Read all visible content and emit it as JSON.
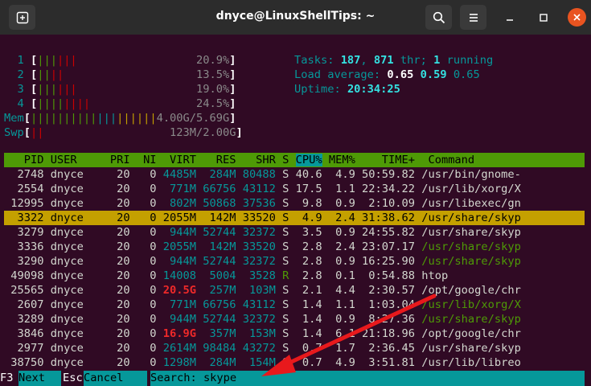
{
  "window": {
    "title": "dnyce@LinuxShellTips: ~"
  },
  "meters": {
    "cpu": [
      {
        "label": "1",
        "bars": "||||||",
        "pct": "20.9%"
      },
      {
        "label": "2",
        "bars": "||||",
        "pct": "13.5%"
      },
      {
        "label": "3",
        "bars": "||||||",
        "pct": "19.0%"
      },
      {
        "label": "4",
        "bars": "||||||||",
        "pct": "24.5%"
      }
    ],
    "mem": {
      "label": "Mem",
      "bars": "|||||||||||||||||||",
      "used": "4.00G",
      "total": "5.69G"
    },
    "swp": {
      "label": "Swp",
      "bars": "||",
      "used": "123M",
      "total": "2.00G"
    }
  },
  "summary": {
    "tasks_label": "Tasks: ",
    "tasks": "187",
    "sep1": ", ",
    "thr": "871",
    "thr_label": " thr; ",
    "running": "1",
    "running_label": " running",
    "load_label": "Load average: ",
    "load1": "0.65",
    "load5": "0.59",
    "load15": "0.65",
    "uptime_label": "Uptime: ",
    "uptime": "20:34:25"
  },
  "table": {
    "headers": {
      "pid": "PID",
      "user": "USER",
      "pri": "PRI",
      "ni": "NI",
      "virt": "VIRT",
      "res": "RES",
      "shr": "SHR",
      "s": "S",
      "cpu": "CPU%",
      "mem": "MEM%",
      "time": "TIME+",
      "cmd": "Command"
    },
    "rows": [
      {
        "pid": "2748",
        "user": "dnyce",
        "pri": "20",
        "ni": "0",
        "virt": "4485M",
        "res": "284M",
        "shr": "80488",
        "s": "S",
        "cpu": "40.6",
        "mem": "4.9",
        "time": "50:59.82",
        "cmd": "/usr/bin/gnome-"
      },
      {
        "pid": "2554",
        "user": "dnyce",
        "pri": "20",
        "ni": "0",
        "virt": "771M",
        "res": "66756",
        "shr": "43112",
        "s": "S",
        "cpu": "17.5",
        "mem": "1.1",
        "time": "22:34.22",
        "cmd": "/usr/lib/xorg/X"
      },
      {
        "pid": "12995",
        "user": "dnyce",
        "pri": "20",
        "ni": "0",
        "virt": "802M",
        "res": "50868",
        "shr": "37536",
        "s": "S",
        "cpu": "9.8",
        "mem": "0.9",
        "time": "2:10.09",
        "cmd": "/usr/libexec/gn"
      },
      {
        "pid": "3322",
        "user": "dnyce",
        "pri": "20",
        "ni": "0",
        "virt": "2055M",
        "res": "142M",
        "shr": "33520",
        "s": "S",
        "cpu": "4.9",
        "mem": "2.4",
        "time": "31:38.62",
        "cmd": "/usr/share/skyp"
      },
      {
        "pid": "3279",
        "user": "dnyce",
        "pri": "20",
        "ni": "0",
        "virt": "944M",
        "res": "52744",
        "shr": "32372",
        "s": "S",
        "cpu": "3.5",
        "mem": "0.9",
        "time": "24:55.82",
        "cmd": "/usr/share/skyp"
      },
      {
        "pid": "3336",
        "user": "dnyce",
        "pri": "20",
        "ni": "0",
        "virt": "2055M",
        "res": "142M",
        "shr": "33520",
        "s": "S",
        "cpu": "2.8",
        "mem": "2.4",
        "time": "23:07.17",
        "cmd": "/usr/share/skyp"
      },
      {
        "pid": "3290",
        "user": "dnyce",
        "pri": "20",
        "ni": "0",
        "virt": "944M",
        "res": "52744",
        "shr": "32372",
        "s": "S",
        "cpu": "2.8",
        "mem": "0.9",
        "time": "16:25.90",
        "cmd": "/usr/share/skyp"
      },
      {
        "pid": "49098",
        "user": "dnyce",
        "pri": "20",
        "ni": "0",
        "virt": "14008",
        "res": "5004",
        "shr": "3528",
        "s": "R",
        "cpu": "2.8",
        "mem": "0.1",
        "time": "0:54.88",
        "cmd": "htop"
      },
      {
        "pid": "25565",
        "user": "dnyce",
        "pri": "20",
        "ni": "0",
        "virt": "20.5G",
        "res": "257M",
        "shr": "103M",
        "s": "S",
        "cpu": "2.1",
        "mem": "4.4",
        "time": "2:30.57",
        "cmd": "/opt/google/chr"
      },
      {
        "pid": "2607",
        "user": "dnyce",
        "pri": "20",
        "ni": "0",
        "virt": "771M",
        "res": "66756",
        "shr": "43112",
        "s": "S",
        "cpu": "1.4",
        "mem": "1.1",
        "time": "1:03.04",
        "cmd": "/usr/lib/xorg/X"
      },
      {
        "pid": "3289",
        "user": "dnyce",
        "pri": "20",
        "ni": "0",
        "virt": "944M",
        "res": "52744",
        "shr": "32372",
        "s": "S",
        "cpu": "1.4",
        "mem": "0.9",
        "time": "8:27.36",
        "cmd": "/usr/share/skyp"
      },
      {
        "pid": "3846",
        "user": "dnyce",
        "pri": "20",
        "ni": "0",
        "virt": "16.9G",
        "res": "357M",
        "shr": "153M",
        "s": "S",
        "cpu": "1.4",
        "mem": "6.1",
        "time": "21:18.96",
        "cmd": "/opt/google/chr"
      },
      {
        "pid": "2977",
        "user": "dnyce",
        "pri": "20",
        "ni": "0",
        "virt": "2614M",
        "res": "98484",
        "shr": "43272",
        "s": "S",
        "cpu": "0.7",
        "mem": "1.7",
        "time": "2:36.45",
        "cmd": "/usr/share/skyp"
      },
      {
        "pid": "38750",
        "user": "dnyce",
        "pri": "20",
        "ni": "0",
        "virt": "1298M",
        "res": "284M",
        "shr": "154M",
        "s": "S",
        "cpu": "0.7",
        "mem": "4.9",
        "time": "3:51.81",
        "cmd": "/usr/lib/libreo"
      }
    ]
  },
  "footer": {
    "f3": "F3",
    "next": "Next  ",
    "esc": "Esc",
    "cancel": "Cancel  ",
    "search_label": "Search: ",
    "search_value": "skype"
  },
  "colors": {
    "accent_arrow": "#e8191c",
    "header_bg": "#4e9a06",
    "selected_bg": "#c4a000",
    "footer_bg": "#06989a"
  }
}
